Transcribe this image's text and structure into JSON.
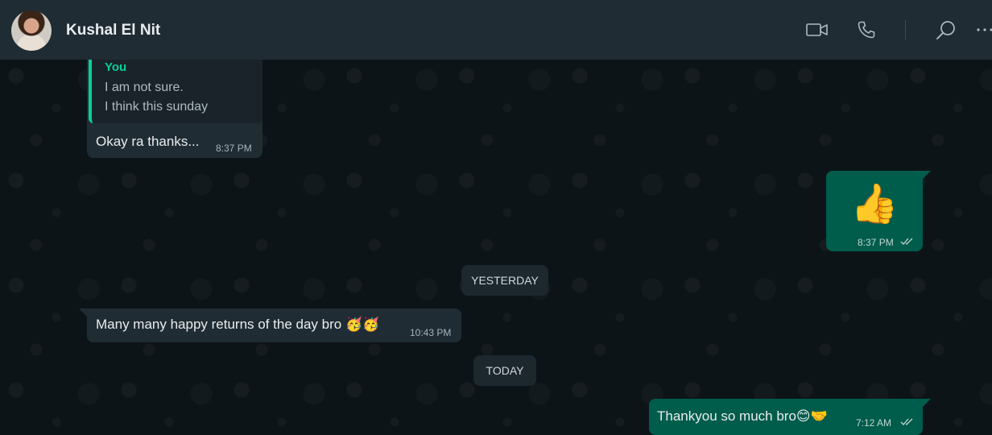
{
  "header": {
    "contact_name": "Kushal El Nit",
    "icons": [
      "video-call-icon",
      "voice-call-icon",
      "search-icon",
      "menu-icon"
    ]
  },
  "messages": [
    {
      "direction": "incoming",
      "quoted_author": "You",
      "quoted_lines": [
        "I am not sure.",
        "I think this sunday"
      ],
      "text": "Okay ra thanks...",
      "time": "8:37 PM"
    },
    {
      "direction": "outgoing",
      "text": "👍",
      "time": "8:37 PM",
      "status": "read"
    },
    {
      "direction": "incoming",
      "text": "Many many happy returns of the day bro 🥳🥳",
      "time": "10:43 PM"
    },
    {
      "direction": "outgoing",
      "text": "Thankyou so much bro😊🤝",
      "time": "7:12 AM",
      "status": "read"
    }
  ],
  "day_separators": [
    "YESTERDAY",
    "TODAY"
  ],
  "colors": {
    "header": "#202c33",
    "incoming_bubble": "#202c33",
    "outgoing_bubble": "#005c4b",
    "quote_accent": "#06cf9c",
    "background": "#0b141a"
  }
}
